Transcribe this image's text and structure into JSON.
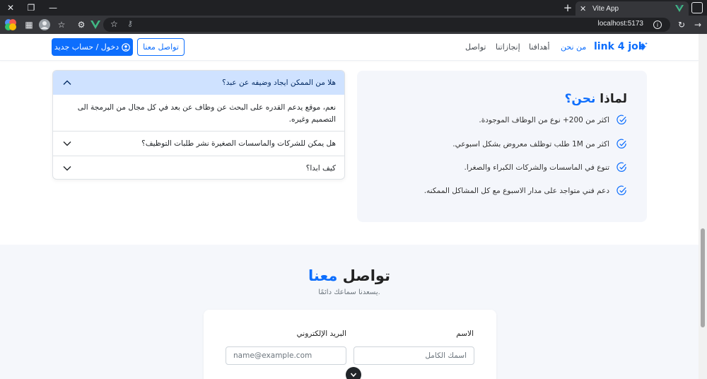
{
  "browser": {
    "tab_title": "Vite App",
    "url": "localhost:5173"
  },
  "navbar": {
    "brand": "link 4 job",
    "links": [
      "من نحن",
      "أهدافنا",
      "إنجازاتنا",
      "تواصل"
    ],
    "contact_button": "تواصل معنا",
    "login_button": "دخول / حساب جديد"
  },
  "why_us": {
    "title_part1": "لماذا ",
    "title_part2": "نحن؟",
    "items": [
      "اكثر من 200+ نوع من الوظاف الموجودة.",
      "اكثر من 1M طلب توظلف معروض بشكل اسبوعي.",
      "تنوع في الماسسات والشركات الكبراء والصغرا.",
      "دعم فني متواجد على مدار الاسبوع مع كل المشاكل الممكنه."
    ]
  },
  "faq": {
    "items": [
      {
        "question": "هلا من الممكن ايجاد وضيفه عن عبد؟",
        "answer": "نعم، موقع يدعم القدره على البحث عن وظاف عن بعد في كل مجال من البرمجة الى التصميم وغيره.",
        "open": true
      },
      {
        "question": "هل يمكن للشركات والماسسات الصغيرة نشر طلبات التوظيف؟",
        "open": false
      },
      {
        "question": "كيف ابدا؟",
        "open": false
      }
    ]
  },
  "contact": {
    "title_part1": "تواصل ",
    "title_part2": "معنا",
    "subtitle": "يسعدنا سماعك دائمًا.",
    "name_label": "الاسم",
    "name_placeholder": "اسمك الكامل",
    "email_label": "البريد الإلكتروني",
    "email_placeholder": "name@example.com"
  },
  "colors": {
    "primary": "#0d6efd",
    "accordion_open": "#cfe2ff",
    "card_bg": "#f4f6fb"
  }
}
